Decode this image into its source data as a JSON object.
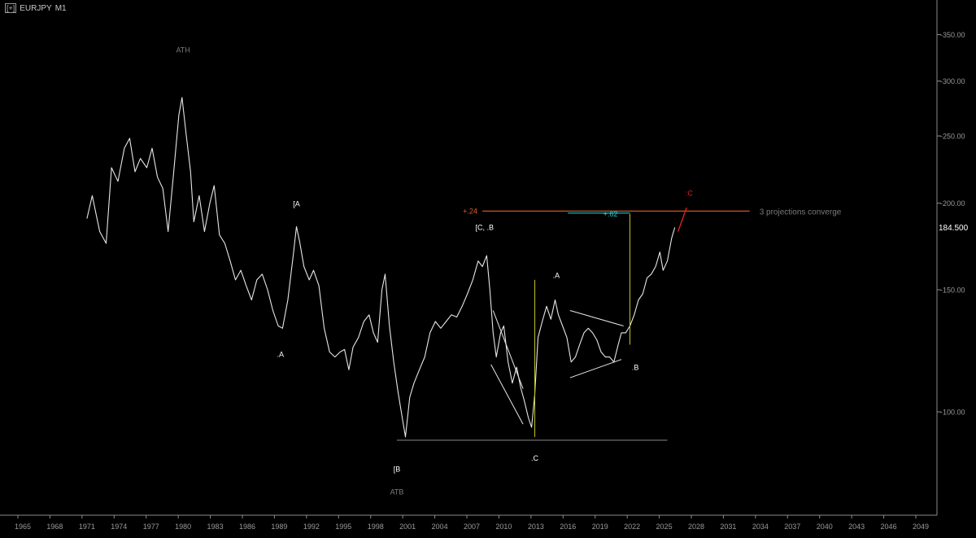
{
  "header": {
    "expand_label": "[+]",
    "symbol": "EURJPY",
    "timeframe": "M1"
  },
  "colors": {
    "background": "#000000",
    "price": "#e6e6e6",
    "axis_text": "#9a9a9a",
    "projection_orange": "#e0622b",
    "projection_cyan": "#2ec4c4",
    "projection_red": "#d92121",
    "measure_yellow": "#c8c42a",
    "annotation_grey": "#7a7a7a",
    "label_white": "#ffffff"
  },
  "chart_data": {
    "type": "line",
    "symbol": "EURJPY",
    "timeframe": "M1",
    "scale": "log",
    "x_ticks": [
      "1965",
      "1968",
      "1971",
      "1974",
      "1977",
      "1980",
      "1983",
      "1986",
      "1989",
      "1992",
      "1995",
      "1998",
      "2001",
      "2004",
      "2007",
      "2010",
      "2013",
      "2016",
      "2019",
      "2022",
      "2025",
      "2028",
      "2031",
      "2034",
      "2037",
      "2040",
      "2043",
      "2046",
      "2049"
    ],
    "y_ticks": [
      "350.00",
      "300.00",
      "250.00",
      "200.00",
      "150.00",
      "100.00"
    ],
    "last_price": "184.500",
    "series": [
      {
        "points": [
          [
            1971.0,
            190
          ],
          [
            1971.5,
            205
          ],
          [
            1972.2,
            182
          ],
          [
            1972.8,
            175
          ],
          [
            1973.3,
            225
          ],
          [
            1973.9,
            215
          ],
          [
            1974.5,
            240
          ],
          [
            1975.0,
            248
          ],
          [
            1975.5,
            222
          ],
          [
            1976.0,
            232
          ],
          [
            1976.6,
            225
          ],
          [
            1977.1,
            240
          ],
          [
            1977.6,
            218
          ],
          [
            1978.1,
            210
          ],
          [
            1978.6,
            182
          ],
          [
            1979.1,
            220
          ],
          [
            1979.6,
            268
          ],
          [
            1979.9,
            284
          ],
          [
            1980.3,
            250
          ],
          [
            1980.7,
            222
          ],
          [
            1981.0,
            188
          ],
          [
            1981.5,
            205
          ],
          [
            1982.0,
            182
          ],
          [
            1982.5,
            200
          ],
          [
            1982.9,
            212
          ],
          [
            1983.4,
            180
          ],
          [
            1983.9,
            175
          ],
          [
            1984.4,
            165
          ],
          [
            1984.9,
            155
          ],
          [
            1985.4,
            160
          ],
          [
            1985.9,
            152
          ],
          [
            1986.4,
            145
          ],
          [
            1986.9,
            155
          ],
          [
            1987.4,
            158
          ],
          [
            1987.9,
            150
          ],
          [
            1988.4,
            140
          ],
          [
            1988.9,
            133
          ],
          [
            1989.3,
            132
          ],
          [
            1989.8,
            145
          ],
          [
            1990.3,
            168
          ],
          [
            1990.6,
            185
          ],
          [
            1990.9,
            176
          ],
          [
            1991.3,
            162
          ],
          [
            1991.8,
            155
          ],
          [
            1992.2,
            160
          ],
          [
            1992.7,
            152
          ],
          [
            1993.2,
            132
          ],
          [
            1993.7,
            122
          ],
          [
            1994.2,
            120
          ],
          [
            1994.7,
            122
          ],
          [
            1995.1,
            123
          ],
          [
            1995.5,
            115
          ],
          [
            1995.9,
            124
          ],
          [
            1996.4,
            128
          ],
          [
            1996.9,
            135
          ],
          [
            1997.4,
            138
          ],
          [
            1997.8,
            130
          ],
          [
            1998.2,
            126
          ],
          [
            1998.6,
            150
          ],
          [
            1998.9,
            158
          ],
          [
            1999.3,
            133
          ],
          [
            1999.7,
            118
          ],
          [
            2000.1,
            107
          ],
          [
            2000.5,
            98
          ],
          [
            2000.8,
            92
          ],
          [
            2001.2,
            105
          ],
          [
            2001.6,
            110
          ],
          [
            2002.1,
            115
          ],
          [
            2002.6,
            120
          ],
          [
            2003.1,
            130
          ],
          [
            2003.6,
            135
          ],
          [
            2004.1,
            132
          ],
          [
            2004.6,
            135
          ],
          [
            2005.1,
            138
          ],
          [
            2005.6,
            137
          ],
          [
            2006.1,
            142
          ],
          [
            2006.6,
            148
          ],
          [
            2007.1,
            155
          ],
          [
            2007.6,
            165
          ],
          [
            2008.0,
            162
          ],
          [
            2008.4,
            168
          ],
          [
            2008.7,
            150
          ],
          [
            2009.0,
            130
          ],
          [
            2009.3,
            120
          ],
          [
            2009.7,
            130
          ],
          [
            2010.0,
            133
          ],
          [
            2010.4,
            118
          ],
          [
            2010.8,
            110
          ],
          [
            2011.2,
            116
          ],
          [
            2011.6,
            108
          ],
          [
            2011.9,
            104
          ],
          [
            2012.3,
            98
          ],
          [
            2012.6,
            95
          ],
          [
            2012.9,
            106
          ],
          [
            2013.2,
            128
          ],
          [
            2013.6,
            135
          ],
          [
            2014.0,
            142
          ],
          [
            2014.4,
            136
          ],
          [
            2014.8,
            145
          ],
          [
            2015.1,
            138
          ],
          [
            2015.5,
            133
          ],
          [
            2015.9,
            128
          ],
          [
            2016.3,
            118
          ],
          [
            2016.7,
            120
          ],
          [
            2017.1,
            125
          ],
          [
            2017.5,
            130
          ],
          [
            2017.9,
            132
          ],
          [
            2018.3,
            130
          ],
          [
            2018.7,
            127
          ],
          [
            2019.1,
            122
          ],
          [
            2019.5,
            120
          ],
          [
            2019.9,
            120
          ],
          [
            2020.3,
            118
          ],
          [
            2020.7,
            125
          ],
          [
            2021.0,
            130
          ],
          [
            2021.4,
            130
          ],
          [
            2021.8,
            133
          ],
          [
            2022.2,
            138
          ],
          [
            2022.6,
            145
          ],
          [
            2023.0,
            148
          ],
          [
            2023.4,
            156
          ],
          [
            2023.8,
            158
          ],
          [
            2024.2,
            162
          ],
          [
            2024.6,
            170
          ],
          [
            2024.9,
            160
          ],
          [
            2025.3,
            165
          ],
          [
            2025.7,
            178
          ],
          [
            2026.0,
            184.5
          ]
        ]
      }
    ],
    "annotations": [
      {
        "text": "ATH",
        "x": 1980.0,
        "y": 330
      },
      {
        "text": "[A",
        "x": 1990.6,
        "y": 198
      },
      {
        "text": ".A",
        "x": 1989.1,
        "y": 120
      },
      {
        "text": "[C, .B",
        "x": 2008.2,
        "y": 183
      },
      {
        "text": ".A",
        "x": 2014.9,
        "y": 156
      },
      {
        "text": ".B",
        "x": 2022.3,
        "y": 115
      },
      {
        "text": ".C",
        "x": 2012.9,
        "y": 85
      },
      {
        "text": "[B",
        "x": 2000.0,
        "y": 82
      },
      {
        "text": "ATB",
        "x": 2000.0,
        "y": 76
      }
    ],
    "projections": [
      {
        "label": "+.24",
        "price": 194.8,
        "x_start": 2008.0,
        "x_end": 2033.0,
        "color": "projection_orange"
      },
      {
        "label": "+.62",
        "price": 193.5,
        "x_start": 2016.0,
        "x_end": 2021.8,
        "color": "projection_cyan"
      },
      {
        "label": ":C",
        "color": "projection_red"
      }
    ],
    "converge_note": "3 projections converge"
  }
}
